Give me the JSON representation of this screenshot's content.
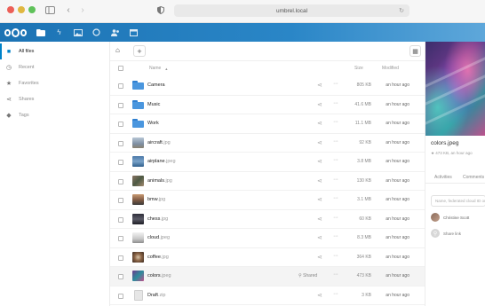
{
  "browser": {
    "url": "umbrel.local"
  },
  "app": {
    "nav_icons": [
      "files-icon",
      "activity-icon",
      "photos-icon",
      "search-icon",
      "contacts-icon",
      "calendar-icon"
    ],
    "accent_color": "#0082c9"
  },
  "sidebar": {
    "items": [
      {
        "label": "All files",
        "icon": "folder-icon",
        "active": true
      },
      {
        "label": "Recent",
        "icon": "clock-icon",
        "active": false
      },
      {
        "label": "Favorites",
        "icon": "star-icon",
        "active": false
      },
      {
        "label": "Shares",
        "icon": "share-icon",
        "active": false
      },
      {
        "label": "Tags",
        "icon": "tag-icon",
        "active": false
      }
    ]
  },
  "table": {
    "headers": {
      "name": "Name",
      "sort": "▲",
      "size": "Size",
      "modified": "Modified"
    },
    "rows": [
      {
        "name": "Camera",
        "ext": "",
        "type": "folder",
        "size": "805 KB",
        "modified": "an hour ago",
        "shared": ""
      },
      {
        "name": "Music",
        "ext": "",
        "type": "folder",
        "size": "41.6 MB",
        "modified": "an hour ago",
        "shared": ""
      },
      {
        "name": "Work",
        "ext": "",
        "type": "folder",
        "size": "11.1 MB",
        "modified": "an hour ago",
        "shared": ""
      },
      {
        "name": "aircraft",
        "ext": ".jpg",
        "type": "image",
        "size": "92 KB",
        "modified": "an hour ago",
        "shared": ""
      },
      {
        "name": "airplane",
        "ext": ".jpeg",
        "type": "image",
        "size": "3.8 MB",
        "modified": "an hour ago",
        "shared": ""
      },
      {
        "name": "animals",
        "ext": ".jpg",
        "type": "image",
        "size": "130 KB",
        "modified": "an hour ago",
        "shared": ""
      },
      {
        "name": "bmw",
        "ext": ".jpg",
        "type": "image",
        "size": "3.1 MB",
        "modified": "an hour ago",
        "shared": ""
      },
      {
        "name": "chess",
        "ext": ".jpg",
        "type": "image",
        "size": "60 KB",
        "modified": "an hour ago",
        "shared": ""
      },
      {
        "name": "cloud",
        "ext": ".jpeg",
        "type": "image",
        "size": "8.3 MB",
        "modified": "an hour ago",
        "shared": ""
      },
      {
        "name": "coffee",
        "ext": ".jpg",
        "type": "image",
        "size": "364 KB",
        "modified": "an hour ago",
        "shared": ""
      },
      {
        "name": "colors",
        "ext": ".jpeg",
        "type": "image",
        "size": "473 KB",
        "modified": "an hour ago",
        "shared": "Shared"
      },
      {
        "name": "Draft",
        "ext": ".zip",
        "type": "archive",
        "size": "3 KB",
        "modified": "an hour ago",
        "shared": ""
      }
    ]
  },
  "details": {
    "title": "colors.jpeg",
    "meta": "473 KB, an hour ago",
    "tabs": [
      "Activities",
      "Comments"
    ],
    "input_placeholder": "Name, federated cloud ID or email address",
    "user": "Christine Scott",
    "share_link": "Share link"
  }
}
